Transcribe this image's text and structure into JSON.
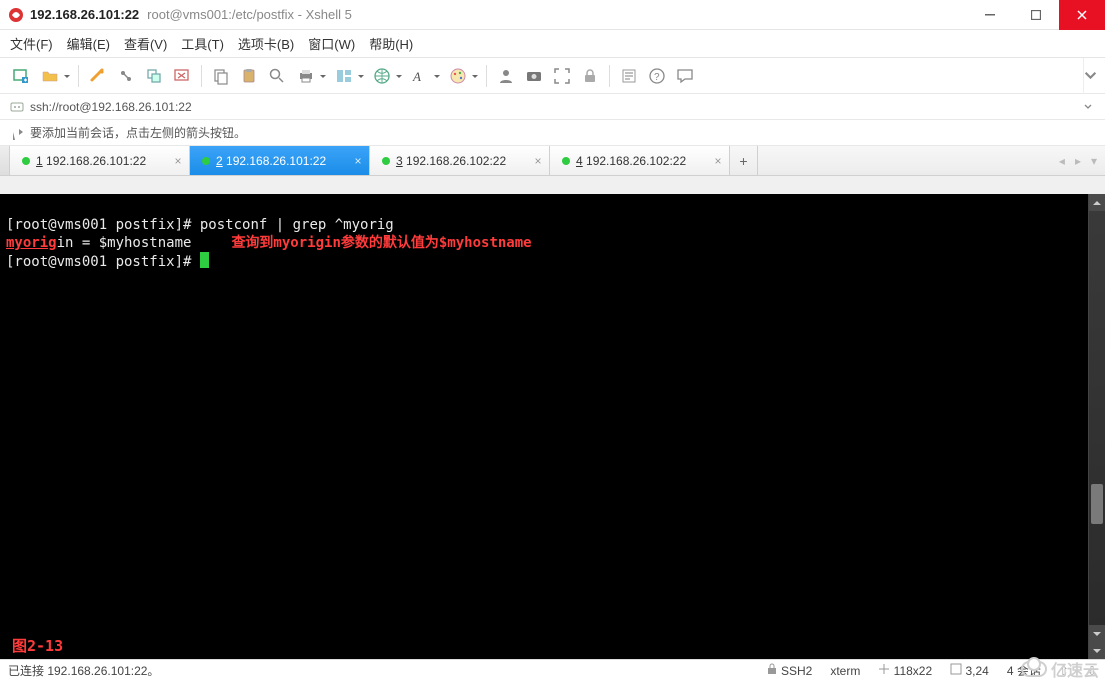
{
  "window": {
    "ip": "192.168.26.101:22",
    "title_suffix": "root@vms001:/etc/postfix - Xshell 5"
  },
  "menu": {
    "file": "文件(F)",
    "edit": "编辑(E)",
    "view": "查看(V)",
    "tools": "工具(T)",
    "tabs": "选项卡(B)",
    "window": "窗口(W)",
    "help": "帮助(H)"
  },
  "address": {
    "url": "ssh://root@192.168.26.101:22",
    "hint": "要添加当前会话，点击左侧的箭头按钮。"
  },
  "tabs": [
    {
      "num": "1",
      "label": "192.168.26.101:22",
      "active": false
    },
    {
      "num": "2",
      "label": "192.168.26.101:22",
      "active": true
    },
    {
      "num": "3",
      "label": "192.168.26.102:22",
      "active": false
    },
    {
      "num": "4",
      "label": "192.168.26.102:22",
      "active": false
    }
  ],
  "terminal": {
    "prompt1_a": "[root@vms001 postfix]# ",
    "cmd1": "postconf | grep ^myorig",
    "line2_a": "myorig",
    "line2_b": "in = $myhostname",
    "annotation": "查询到myorigin参数的默认值为$myhostname",
    "prompt2_a": "[root@vms001 postfix]# ",
    "figure_label": "图2-13"
  },
  "status": {
    "connected": "已连接 192.168.26.101:22。",
    "ssh": "SSH2",
    "term": "xterm",
    "size": "118x22",
    "pos": "3,24",
    "sessions_label": "4 会话"
  },
  "watermark": "亿速云",
  "icons": {
    "new_tab": "new-tab-icon",
    "open": "open-icon",
    "edit_pencil": "pencil-icon",
    "connect": "plug-icon",
    "duplicate": "duplicate-icon",
    "disconnect": "disconnect-icon",
    "copy": "copy-icon",
    "paste": "paste-icon",
    "search": "search-icon",
    "print": "print-icon",
    "layout": "layout-icon",
    "globe": "globe-icon",
    "font": "font-icon",
    "appearance": "palette-icon",
    "user": "user-icon",
    "screenshot": "camera-icon",
    "fullscreen": "fullscreen-icon",
    "lock": "lock-icon",
    "properties": "list-icon",
    "help": "help-icon",
    "chat": "chat-icon"
  }
}
